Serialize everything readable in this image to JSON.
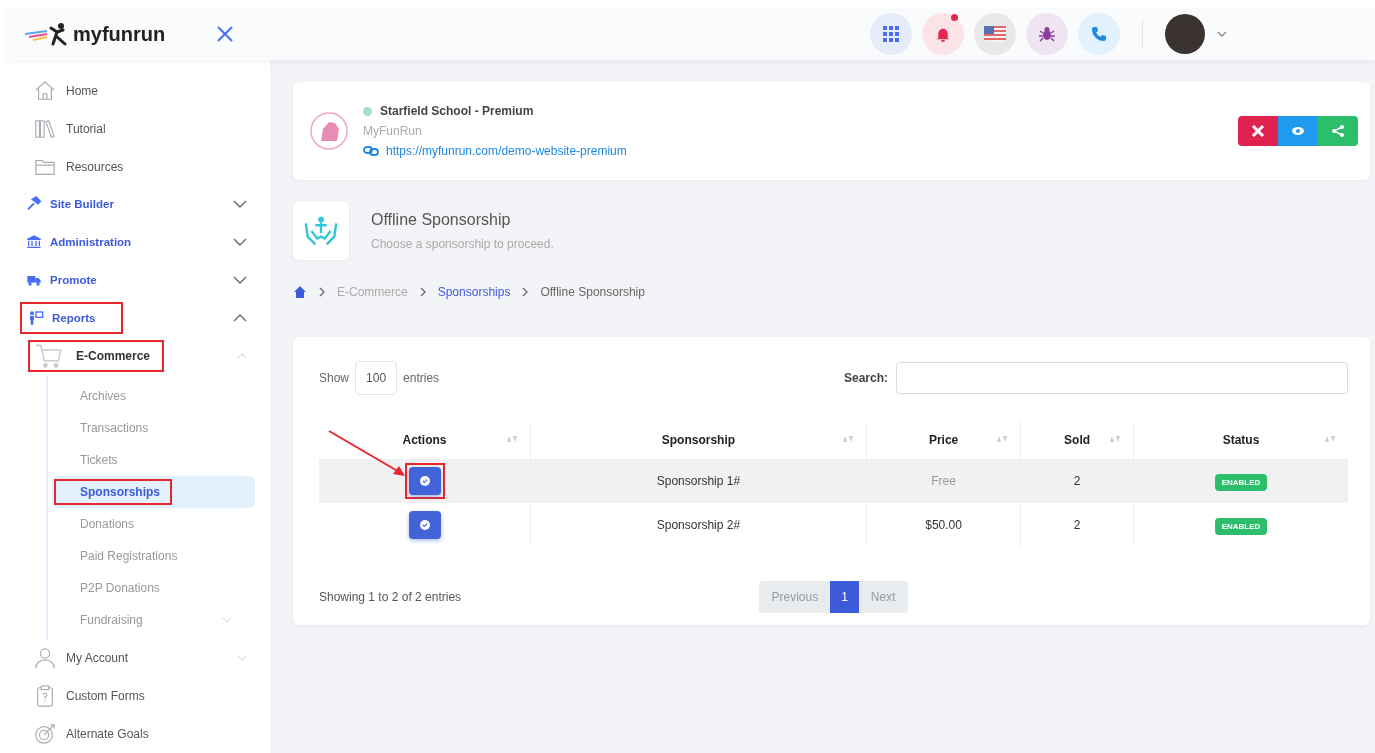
{
  "topbar": {
    "logo": "myfunrun",
    "notification_dot": true
  },
  "sidebar": {
    "items": [
      {
        "label": "Home",
        "kind": "link"
      },
      {
        "label": "Tutorial",
        "kind": "link"
      },
      {
        "label": "Resources",
        "kind": "link"
      },
      {
        "label": "Site Builder",
        "kind": "group",
        "expanded": false,
        "highlighted": false
      },
      {
        "label": "Administration",
        "kind": "group",
        "expanded": false,
        "highlighted": false
      },
      {
        "label": "Promote",
        "kind": "group",
        "expanded": false,
        "highlighted": false
      },
      {
        "label": "Reports",
        "kind": "group",
        "expanded": true,
        "highlighted": true,
        "children": [
          {
            "label": "E-Commerce",
            "expanded": true,
            "highlighted": true,
            "children": [
              {
                "label": "Archives",
                "selected": false,
                "highlighted": false
              },
              {
                "label": "Transactions",
                "selected": false,
                "highlighted": false
              },
              {
                "label": "Tickets",
                "selected": false,
                "highlighted": false
              },
              {
                "label": "Sponsorships",
                "selected": true,
                "highlighted": true
              },
              {
                "label": "Donations",
                "selected": false,
                "highlighted": false
              },
              {
                "label": "Paid Registrations",
                "selected": false,
                "highlighted": false
              },
              {
                "label": "P2P Donations",
                "selected": false,
                "highlighted": false
              },
              {
                "label": "Fundraising",
                "selected": false,
                "highlighted": false,
                "expanded": false
              }
            ]
          }
        ]
      },
      {
        "label": "My Account",
        "kind": "link",
        "expanded": false
      },
      {
        "label": "Custom Forms",
        "kind": "link"
      },
      {
        "label": "Alternate Goals",
        "kind": "link"
      }
    ]
  },
  "site_card": {
    "title": "Starfield School - Premium",
    "online": true,
    "subtitle": "MyFunRun",
    "url": "https://myfunrun.com/demo-website-premium"
  },
  "page_header": {
    "title": "Offline Sponsorship",
    "subtitle": "Choose a sponsorship to proceed."
  },
  "breadcrumb": [
    {
      "label": "E-Commerce",
      "kind": "muted"
    },
    {
      "label": "Sponsorships",
      "kind": "link"
    },
    {
      "label": "Offline Sponsorship",
      "kind": "current"
    }
  ],
  "table": {
    "show_label": "Show",
    "entries_value": "100",
    "entries_label": "entries",
    "search_label": "Search:",
    "columns": [
      "Actions",
      "Sponsorship",
      "Price",
      "Sold",
      "Status"
    ],
    "rows": [
      {
        "sponsorship": "Sponsorship 1#",
        "price": "Free",
        "price_muted": true,
        "sold": "2",
        "status": "ENABLED",
        "highlighted": true,
        "hovered": true
      },
      {
        "sponsorship": "Sponsorship 2#",
        "price": "$50.00",
        "price_muted": false,
        "sold": "2",
        "status": "ENABLED",
        "highlighted": false,
        "hovered": false
      }
    ],
    "info": "Showing 1 to 2 of 2 entries",
    "pagination": [
      {
        "label": "Previous",
        "kind": "nav",
        "selected": false
      },
      {
        "label": "1",
        "kind": "page",
        "selected": true
      },
      {
        "label": "Next",
        "kind": "nav",
        "selected": false
      }
    ]
  }
}
